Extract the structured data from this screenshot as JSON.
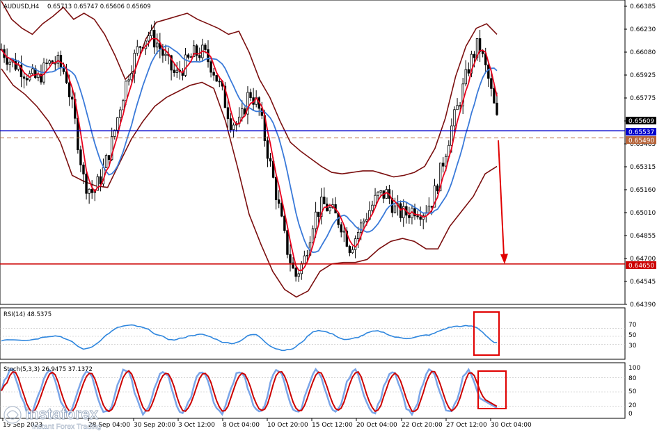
{
  "header": {
    "symbol": "AUDUSD,H4",
    "ohlc": "0.65713 0.65747 0.65606 0.65609"
  },
  "price_axis": {
    "ticks": [
      "0.66385",
      "0.66230",
      "0.66080",
      "0.65925",
      "0.65775",
      "0.65625",
      "0.65465",
      "0.65315",
      "0.65160",
      "0.65010",
      "0.64855",
      "0.64700",
      "0.64545",
      "0.64390"
    ],
    "current_price": "0.65609",
    "blue_level": "0.65537",
    "brown_level": "0.65490",
    "red_level": "0.64650"
  },
  "time_axis": {
    "labels": [
      "19 Sep 2023",
      "28 Sep 04:00",
      "30 Sep 20:00",
      "3 Oct 12:00",
      "8 Oct 04:00",
      "10 Oct 20:00",
      "15 Oct 12:00",
      "20 Oct 04:00",
      "22 Oct 20:00",
      "27 Oct 12:00",
      "30 Oct 04:00"
    ]
  },
  "rsi": {
    "title": "RSI(14) 48.5375",
    "ticks": [
      "70",
      "50",
      "30"
    ]
  },
  "stoch": {
    "title": "Stoch(5,3,3) 26.9475 37.1372",
    "ticks": [
      "100",
      "80",
      "50",
      "20",
      "0"
    ]
  },
  "watermark": {
    "brand": "instaforex",
    "tagline": "Instant Forex Trading"
  },
  "colors": {
    "candles": "#000000",
    "bollinger": "#7b0f0f",
    "fast_ma": "#e8001c",
    "slow_ma": "#3a7ad9",
    "blue_level": "#0000cc",
    "brown_level": "#b5643a",
    "red_level": "#cc0000",
    "rsi_line": "#2e86de",
    "stoch_main": "#7aa5e8",
    "stoch_signal": "#cc0000",
    "arrow": "#e00000",
    "highlight_box": "#e00000"
  },
  "chart_data": {
    "type": "candlestick",
    "ylim": [
      0.6439,
      0.6639
    ],
    "close_path": [
      0.6608,
      0.66,
      0.6596,
      0.659,
      0.6588,
      0.6598,
      0.66,
      0.6592,
      0.656,
      0.652,
      0.6512,
      0.6525,
      0.6545,
      0.6572,
      0.6595,
      0.661,
      0.6618,
      0.6612,
      0.66,
      0.659,
      0.6598,
      0.6605,
      0.6606,
      0.6596,
      0.658,
      0.656,
      0.6558,
      0.658,
      0.657,
      0.654,
      0.651,
      0.6478,
      0.6456,
      0.6468,
      0.6495,
      0.6505,
      0.65,
      0.6492,
      0.6476,
      0.6488,
      0.65,
      0.651,
      0.6512,
      0.65,
      0.6498,
      0.6502,
      0.65,
      0.6508,
      0.653,
      0.6555,
      0.6575,
      0.6598,
      0.6612,
      0.659,
      0.6561
    ],
    "bollinger_upper": [
      0.664,
      0.6628,
      0.6622,
      0.6618,
      0.6625,
      0.663,
      0.6636,
      0.6628,
      0.6632,
      0.6628,
      0.6618,
      0.6604,
      0.6588,
      0.6595,
      0.6615,
      0.6626,
      0.6628,
      0.663,
      0.6632,
      0.6628,
      0.6625,
      0.6622,
      0.6618,
      0.662,
      0.6606,
      0.6588,
      0.6576,
      0.656,
      0.6546,
      0.654,
      0.6535,
      0.653,
      0.6526,
      0.6525,
      0.6526,
      0.6527,
      0.6527,
      0.6525,
      0.6523,
      0.6524,
      0.6526,
      0.653,
      0.6542,
      0.6562,
      0.659,
      0.661,
      0.6622,
      0.6625,
      0.6618
    ],
    "bollinger_lower": [
      0.6595,
      0.6584,
      0.6578,
      0.657,
      0.656,
      0.6546,
      0.6524,
      0.652,
      0.6517,
      0.6516,
      0.6532,
      0.6548,
      0.656,
      0.657,
      0.6576,
      0.658,
      0.6584,
      0.6586,
      0.6582,
      0.656,
      0.653,
      0.6498,
      0.6478,
      0.646,
      0.6448,
      0.6443,
      0.6447,
      0.646,
      0.6465,
      0.6466,
      0.6466,
      0.6468,
      0.6475,
      0.648,
      0.6482,
      0.648,
      0.6475,
      0.6475,
      0.649,
      0.65,
      0.651,
      0.6525,
      0.653
    ],
    "rsi_levels": [
      70,
      50,
      30
    ],
    "stoch_levels": [
      80,
      50,
      20
    ]
  }
}
